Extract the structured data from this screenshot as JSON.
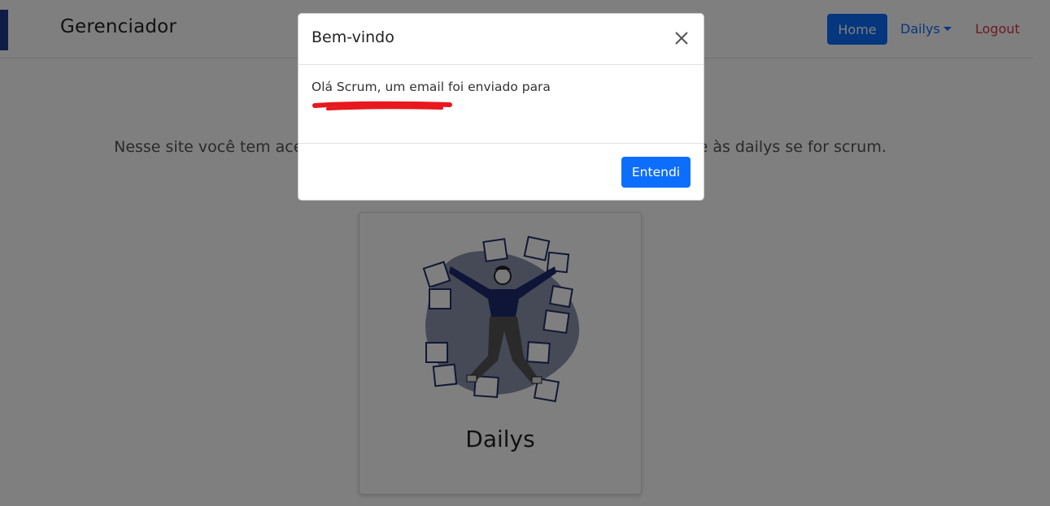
{
  "navbar": {
    "brand": "Gerenciador",
    "home_label": "Home",
    "dailys_label": "Dailys",
    "logout_label": "Logout"
  },
  "main": {
    "intro": "Nesse site você tem acesso ao gerenciamento de presença da sua reunião e às dailys se for scrum.",
    "card_title": "Dailys"
  },
  "modal": {
    "title": "Bem-vindo",
    "message": "Olá Scrum, um email foi enviado para",
    "button_label": "Entendi"
  },
  "colors": {
    "primary": "#0d6efd",
    "danger": "#dc3545",
    "brand_accent": "#1e3a8a",
    "redaction": "#e8181f"
  }
}
